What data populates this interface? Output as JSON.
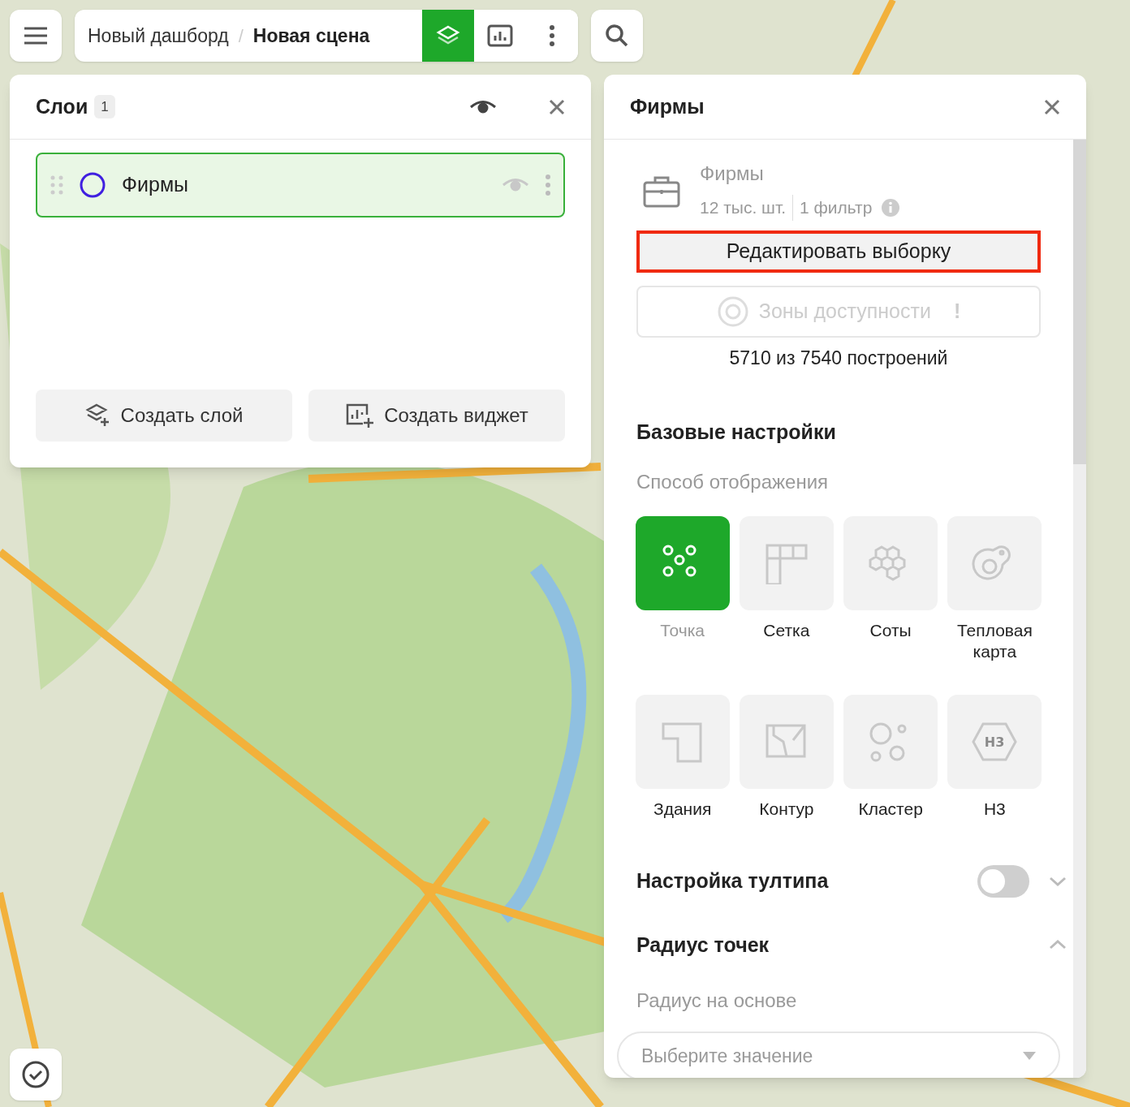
{
  "toolbar": {
    "dashboard": "Новый дашборд",
    "separator": "/",
    "scene": "Новая сцена",
    "buttons": [
      {
        "kind": "layers",
        "selected": true
      },
      {
        "kind": "widgets",
        "selected": false
      },
      {
        "kind": "more",
        "selected": false
      }
    ]
  },
  "layers_panel": {
    "title": "Слои",
    "count": "1",
    "layers": [
      {
        "name": "Фирмы",
        "selected": true,
        "color": "#4020e0"
      }
    ],
    "buttons": [
      {
        "kind": "layer",
        "label": "Создать слой"
      },
      {
        "kind": "widget",
        "label": "Создать виджет"
      }
    ]
  },
  "details_panel": {
    "title": "Фирмы",
    "source": {
      "name": "Фирмы",
      "count": "12 тыс. шт.",
      "filters": "1 фильтр"
    },
    "edit_button": {
      "label": "Редактировать выборку",
      "highlighted": true
    },
    "zones_button": {
      "label": "Зоны доступности",
      "badge": "!",
      "disabled": true
    },
    "quota": "5710 из 7540 построений",
    "section_title": "Базовые настройки",
    "display_label": "Способ отображения",
    "display_modes": [
      {
        "kind": "point",
        "label": "Точка",
        "selected": true
      },
      {
        "kind": "grid",
        "label": "Сетка",
        "selected": false
      },
      {
        "kind": "hex",
        "label": "Соты",
        "selected": false
      },
      {
        "kind": "heat",
        "label": "Тепловая карта",
        "selected": false
      },
      {
        "kind": "building",
        "label": "Здания",
        "selected": false
      },
      {
        "kind": "contour",
        "label": "Контур",
        "selected": false
      },
      {
        "kind": "cluster",
        "label": "Кластер",
        "selected": false
      },
      {
        "kind": "h3",
        "label": "H3",
        "icon_text": "H3",
        "selected": false
      }
    ],
    "tooltip": {
      "title": "Настройка тултипа",
      "on": false,
      "expanded": false
    },
    "radius": {
      "title": "Радиус точек",
      "expanded": true,
      "label": "Радиус на основе",
      "placeholder": "Выберите значение"
    }
  }
}
